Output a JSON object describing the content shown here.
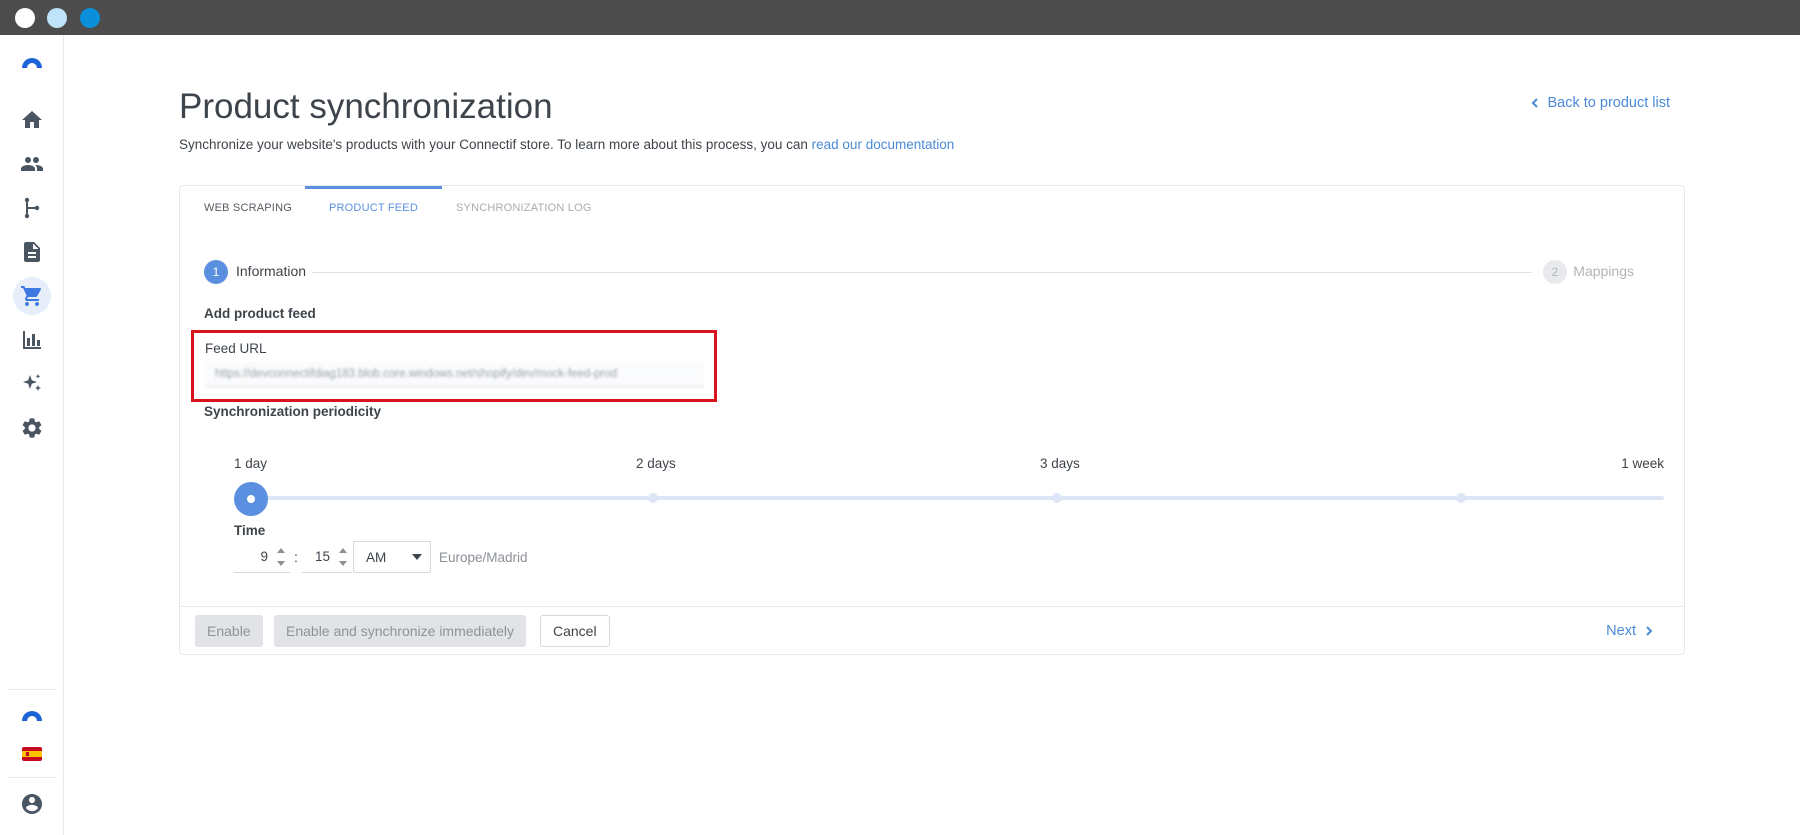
{
  "window": {
    "controls": [
      "close",
      "minimize",
      "maximize"
    ]
  },
  "sidebar": {
    "logo_icon": "connectif-logo-icon",
    "items": [
      {
        "icon": "home-icon",
        "active": false
      },
      {
        "icon": "users-icon",
        "active": false
      },
      {
        "icon": "workflow-icon",
        "active": false
      },
      {
        "icon": "document-icon",
        "active": false
      },
      {
        "icon": "cart-icon",
        "active": true
      },
      {
        "icon": "bar-chart-icon",
        "active": false
      },
      {
        "icon": "sparkles-icon",
        "active": false
      },
      {
        "icon": "gear-icon",
        "active": false
      }
    ],
    "bottom": [
      "account-logo-icon",
      "spain-flag-icon",
      "user-profile-icon"
    ]
  },
  "page": {
    "title": "Product synchronization",
    "subtitle_prefix": "Synchronize your website's products with your Connectif store. To learn more about this process, you can ",
    "subtitle_link": "read our documentation",
    "back_link": "Back to product list"
  },
  "tabs": [
    {
      "label": "WEB SCRAPING",
      "state": "normal"
    },
    {
      "label": "PRODUCT FEED",
      "state": "active"
    },
    {
      "label": "SYNCHRONIZATION LOG",
      "state": "disabled"
    }
  ],
  "stepper": {
    "steps": [
      {
        "number": "1",
        "label": "Information",
        "active": true
      },
      {
        "number": "2",
        "label": "Mappings",
        "active": false
      }
    ]
  },
  "feed": {
    "section_title": "Add product feed",
    "label": "Feed URL",
    "value": "https://devconnectifdiag183.blob.core.windows.net/shopify/dev/mock-feed-prod"
  },
  "periodicity": {
    "section_title": "Synchronization periodicity",
    "options": [
      "1 day",
      "2 days",
      "3 days",
      "1 week"
    ],
    "selected_index": 0
  },
  "time": {
    "label": "Time",
    "hour": "9",
    "separator": ":",
    "minute": "15",
    "meridiem": "AM",
    "timezone": "Europe/Madrid"
  },
  "footer": {
    "enable": "Enable",
    "enable_sync": "Enable and synchronize immediately",
    "cancel": "Cancel",
    "next": "Next"
  },
  "colors": {
    "accent": "#5b8fe0",
    "link": "#4a8ad6",
    "highlight": "#d7141b"
  }
}
